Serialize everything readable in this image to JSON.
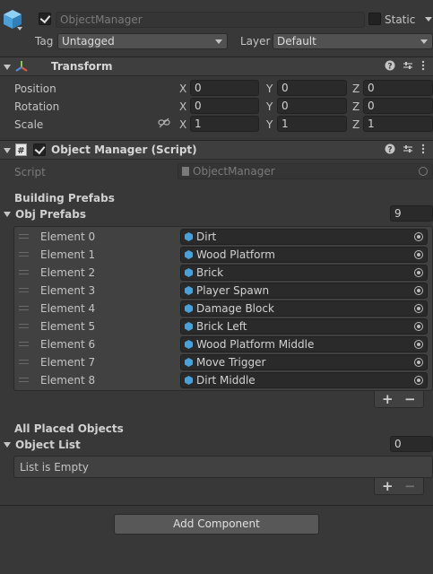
{
  "gameobject": {
    "name": "ObjectManager",
    "active": true,
    "static_label": "Static",
    "static_checked": false,
    "tag_label": "Tag",
    "tag_value": "Untagged",
    "layer_label": "Layer",
    "layer_value": "Default"
  },
  "transform": {
    "title": "Transform",
    "rows": [
      {
        "label": "Position",
        "x": "0",
        "y": "0",
        "z": "0"
      },
      {
        "label": "Rotation",
        "x": "0",
        "y": "0",
        "z": "0"
      },
      {
        "label": "Scale",
        "x": "1",
        "y": "1",
        "z": "1"
      }
    ],
    "axis": {
      "x": "X",
      "y": "Y",
      "z": "Z"
    }
  },
  "script_component": {
    "title": "Object Manager (Script)",
    "enabled": true,
    "script_label": "Script",
    "script_value": "ObjectManager",
    "building_header": "Building Prefabs",
    "obj_prefabs_label": "Obj Prefabs",
    "obj_prefabs_count": "9",
    "elements": [
      {
        "label": "Element 0",
        "value": "Dirt"
      },
      {
        "label": "Element 1",
        "value": "Wood Platform"
      },
      {
        "label": "Element 2",
        "value": "Brick"
      },
      {
        "label": "Element 3",
        "value": "Player Spawn"
      },
      {
        "label": "Element 4",
        "value": "Damage Block"
      },
      {
        "label": "Element 5",
        "value": "Brick Left"
      },
      {
        "label": "Element 6",
        "value": "Wood Platform Middle"
      },
      {
        "label": "Element 7",
        "value": "Move Trigger"
      },
      {
        "label": "Element 8",
        "value": "Dirt Middle"
      }
    ],
    "placed_header": "All Placed Objects",
    "object_list_label": "Object List",
    "object_list_count": "0",
    "empty_text": "List is Empty",
    "plus": "+",
    "minus": "−"
  },
  "add_component_label": "Add Component",
  "colors": {
    "accent_cube": "#4aa0d8",
    "background": "#383838"
  }
}
